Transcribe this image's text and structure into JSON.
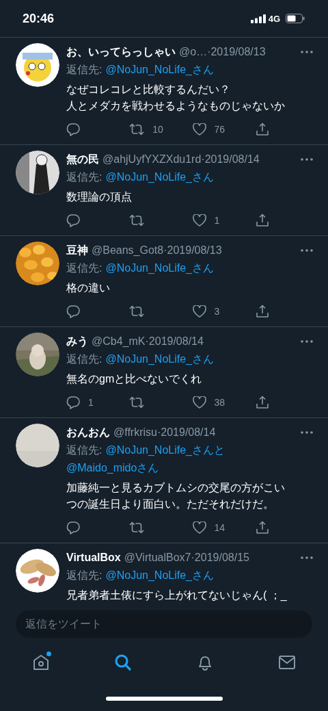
{
  "status_bar": {
    "time": "20:46",
    "network": "4G"
  },
  "tweets": [
    {
      "name": "お、いってらっしゃい",
      "handle": "@o…",
      "date": "·2019/08/13",
      "reply_label": "返信先:",
      "reply_targets": [
        "@NoJun_NoLife_さん"
      ],
      "text": [
        "なぜコレコレと比較するんだい？",
        "人とメダカを戦わせるようなものじゃないか"
      ],
      "retweets": "10",
      "likes": "76"
    },
    {
      "name": "無の民",
      "handle": "@ahjUyfYXZXdu1rd",
      "date": "·2019/08/14",
      "reply_label": "返信先:",
      "reply_targets": [
        "@NoJun_NoLife_さん"
      ],
      "text": [
        "数理論の頂点"
      ],
      "likes": "1"
    },
    {
      "name": "豆神",
      "handle": "@Beans_Got8",
      "date": "·2019/08/13",
      "reply_label": "返信先:",
      "reply_targets": [
        "@NoJun_NoLife_さん"
      ],
      "text": [
        "格の違い"
      ],
      "likes": "3"
    },
    {
      "name": "みう",
      "handle": "@Cb4_mK",
      "date": "·2019/08/14",
      "reply_label": "返信先:",
      "reply_targets": [
        "@NoJun_NoLife_さん"
      ],
      "text": [
        "無名のgmと比べないでくれ"
      ],
      "replies": "1",
      "likes": "38"
    },
    {
      "name": "おんおん",
      "handle": "@ffrkrisu",
      "date": "·2019/08/14",
      "reply_label": "返信先:",
      "reply_targets": [
        "@NoJun_NoLife_さんと",
        "@Maido_midoさん"
      ],
      "text": [
        "加藤純一と見るカブトムシの交尾の方がこい",
        "つの誕生日より面白い。ただそれだけだ。"
      ],
      "likes": "14"
    },
    {
      "name": "VirtualBox",
      "handle": "@VirtualBox7",
      "date": "·2019/08/15",
      "reply_label": "返信先:",
      "reply_targets": [
        "@NoJun_NoLife_さん"
      ],
      "text": [
        "兄者弟者土俵にすら上がれてないじゃん( ；_"
      ],
      "truncated": true
    }
  ],
  "reply_field": {
    "placeholder": "返信をツイート"
  },
  "tabs": [
    {
      "kind": "home",
      "selected": false,
      "notification_dot": true
    },
    {
      "kind": "search",
      "selected": true,
      "notification_dot": false
    },
    {
      "kind": "bell",
      "selected": false,
      "notification_dot": false
    },
    {
      "kind": "mail",
      "selected": false,
      "notification_dot": false
    }
  ]
}
